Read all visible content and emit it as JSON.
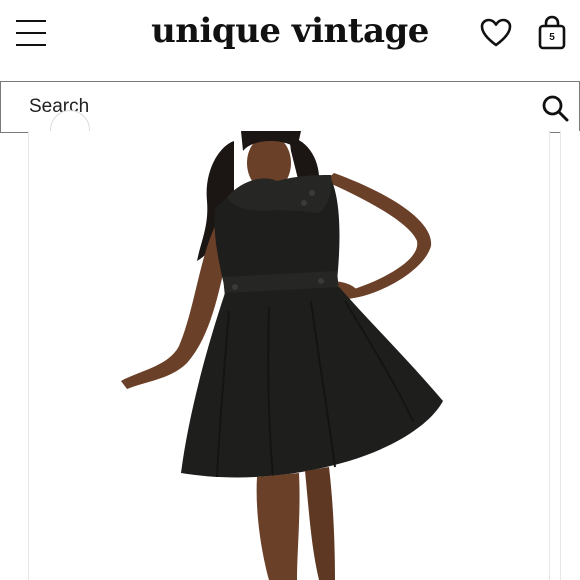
{
  "header": {
    "logo_text": "unique vintage",
    "menu_icon": "hamburger-menu-icon",
    "wishlist_icon": "heart-icon",
    "bag_icon": "shopping-bag-icon",
    "bag_count": "5"
  },
  "search": {
    "placeholder": "Search",
    "icon": "search-icon"
  },
  "product": {
    "image_alt": "",
    "dress_color": "#1e1f1d",
    "skin_color": "#6b4028"
  }
}
